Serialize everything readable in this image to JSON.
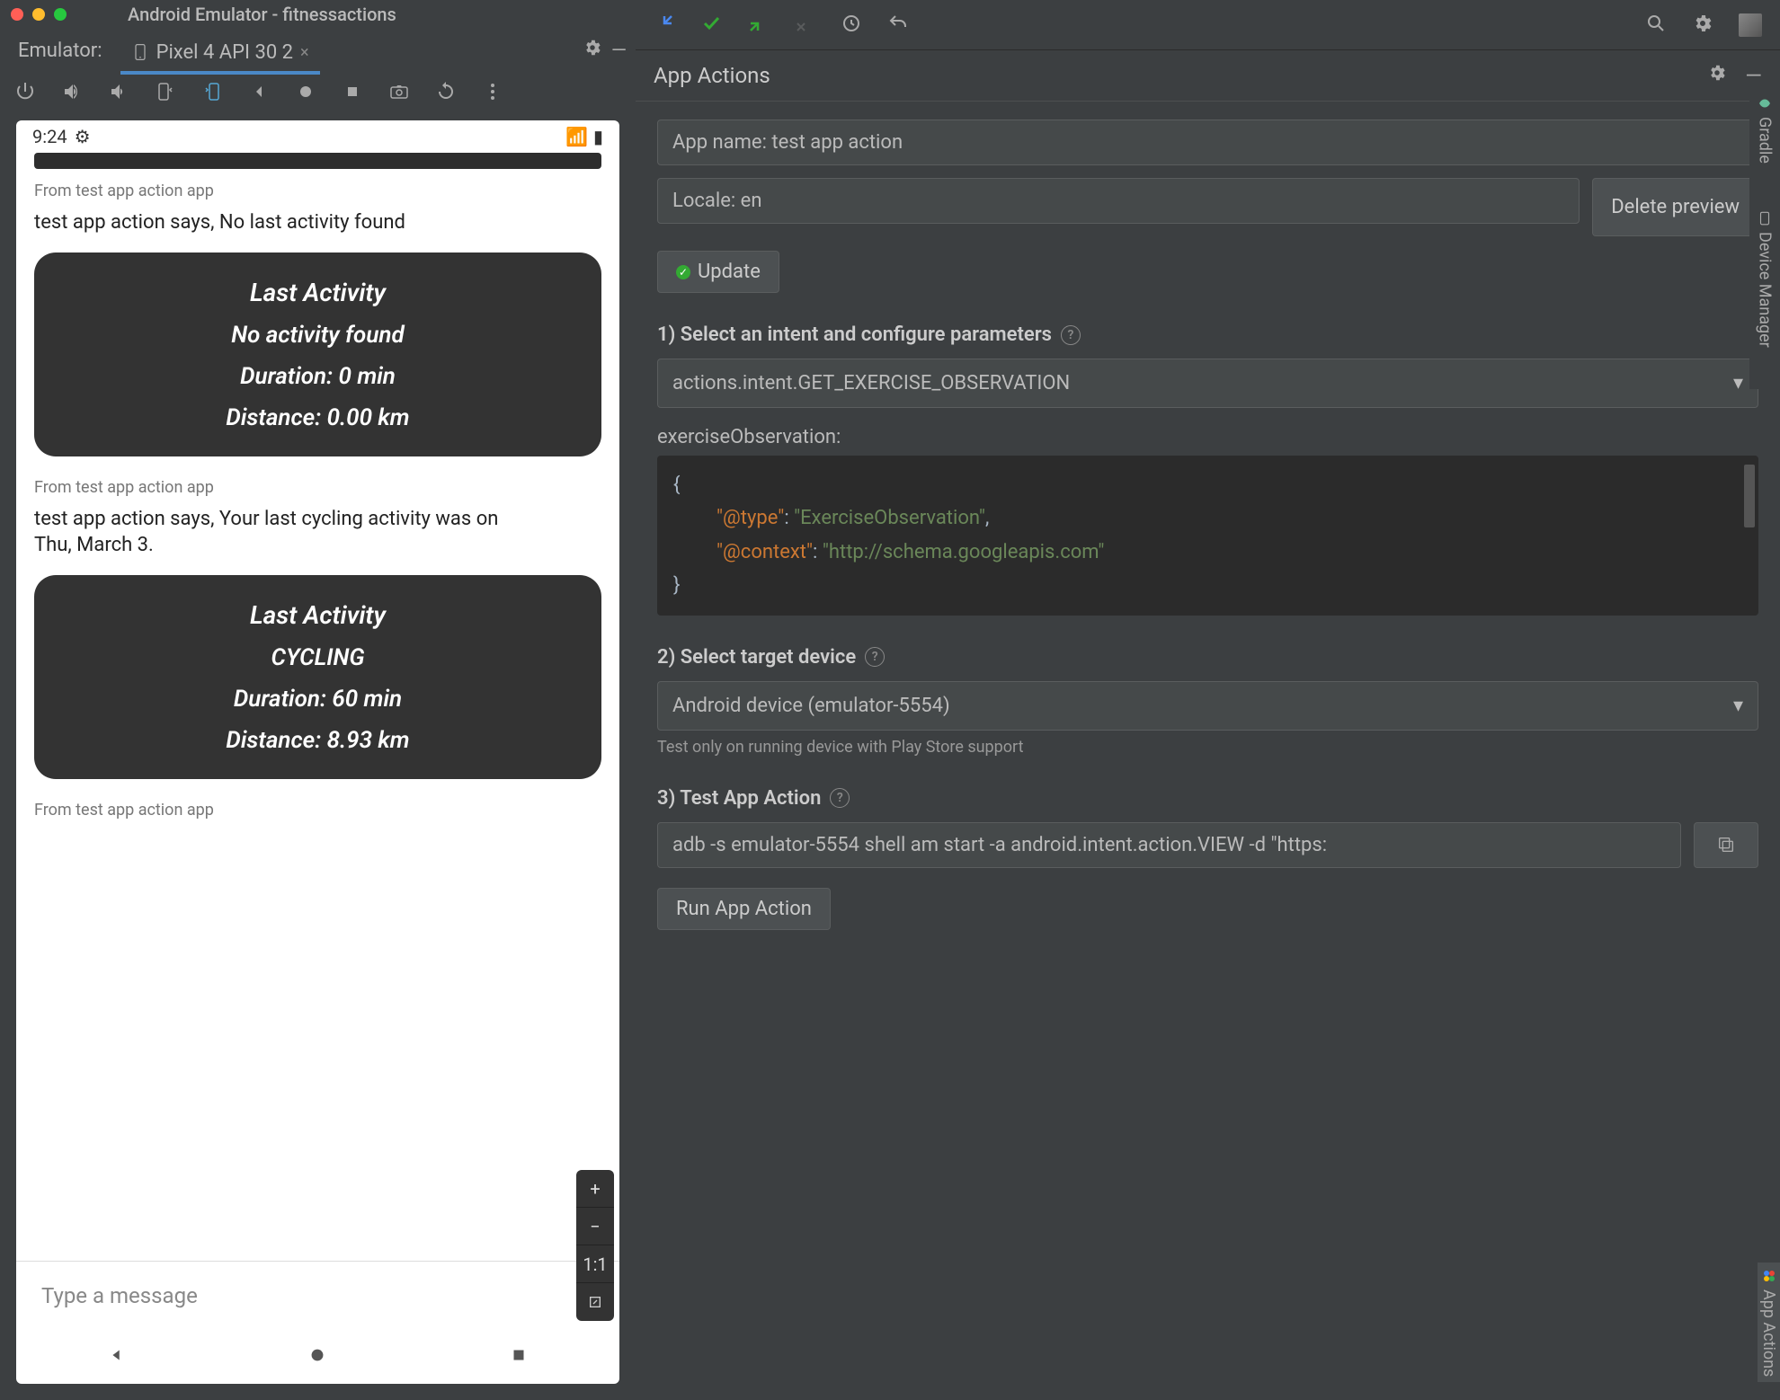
{
  "emulator": {
    "windowTitle": "Android Emulator - fitnessactions",
    "label": "Emulator:",
    "tabName": "Pixel 4 API 30 2",
    "statusTime": "9:24"
  },
  "assistant": {
    "from1": "From test app action app",
    "text1": "test app action says, No last activity found",
    "card1": {
      "title": "Last Activity",
      "sub": "No activity found",
      "dur": "Duration: 0 min",
      "dist": "Distance: 0.00 km"
    },
    "from2": "From test app action app",
    "text2": "test app action says, Your last cycling activity was on Thu, March 3.",
    "card2": {
      "title": "Last Activity",
      "sub": "CYCLING",
      "dur": "Duration: 60 min",
      "dist": "Distance: 8.93 km"
    },
    "from3": "From test app action app",
    "placeholder": "Type a message",
    "zoom11": "1:1"
  },
  "ide": {
    "panelTitle": "App Actions",
    "appName": "App name: test app action",
    "locale": "Locale: en",
    "deletePreview": "Delete preview",
    "update": "Update",
    "step1": "1) Select an intent and configure parameters",
    "intent": "actions.intent.GET_EXERCISE_OBSERVATION",
    "jsonLabel": "exerciseObservation:",
    "json": {
      "l1": "{",
      "l2k": "\"@type\"",
      "l2c": ": ",
      "l2v": "\"ExerciseObservation\"",
      "l2e": ",",
      "l3k": "\"@context\"",
      "l3c": ": ",
      "l3v": "\"http://schema.googleapis.com\"",
      "l4": "}"
    },
    "step2": "2) Select target device",
    "device": "Android device (emulator-5554)",
    "hint": "Test only on running device with Play Store support",
    "step3": "3) Test App Action",
    "adb": "adb -s emulator-5554 shell am start -a android.intent.action.VIEW -d \"https:",
    "run": "Run App Action",
    "sideGradle": "Gradle",
    "sideDevMgr": "Device Manager",
    "sideAppActions": "App Actions"
  }
}
